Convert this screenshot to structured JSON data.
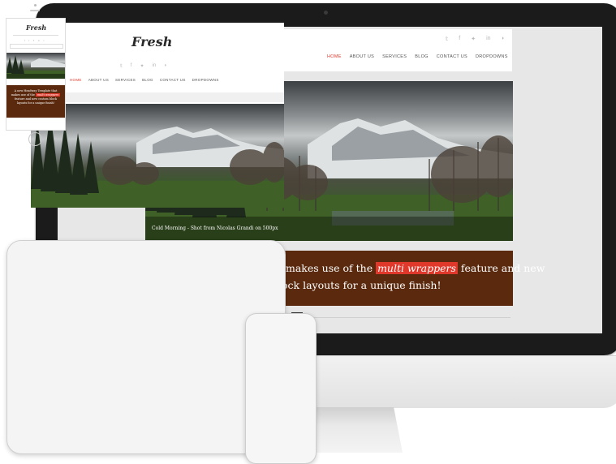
{
  "site": {
    "logo": "Fresh",
    "logo_dot": ".",
    "nav": [
      "HOME",
      "ABOUT US",
      "SERVICES",
      "BLOG",
      "CONTACT US",
      "DROPDOWNS"
    ],
    "social_icons": [
      "twitter-icon",
      "facebook-icon",
      "google-plus-icon",
      "linkedin-icon",
      "rss-icon"
    ],
    "social_glyphs": [
      "𝕥",
      "f",
      "✦",
      "in",
      "◗"
    ],
    "hero_caption": "Cold Morning - Shot from Nicolas Grandi on 500px",
    "promo_before": "t makes use of the ",
    "promo_highlight": "multi wrappers",
    "promo_after": " feature and new",
    "promo_line2": "lock layouts for a unique finish!"
  },
  "phone": {
    "promo_line1": "A new Headway Template that",
    "promo_line2_before": "makes use of the ",
    "promo_line2_highlight": "multi wrappers",
    "promo_line3": "feature and new custom block",
    "promo_line4": "layouts for a unique finish!"
  },
  "colors": {
    "accent": "#e0392b",
    "promo_bg": "#5b2a0e",
    "imac_bezel": "#1b1b1b",
    "screen_bg": "#e7e7e7"
  }
}
